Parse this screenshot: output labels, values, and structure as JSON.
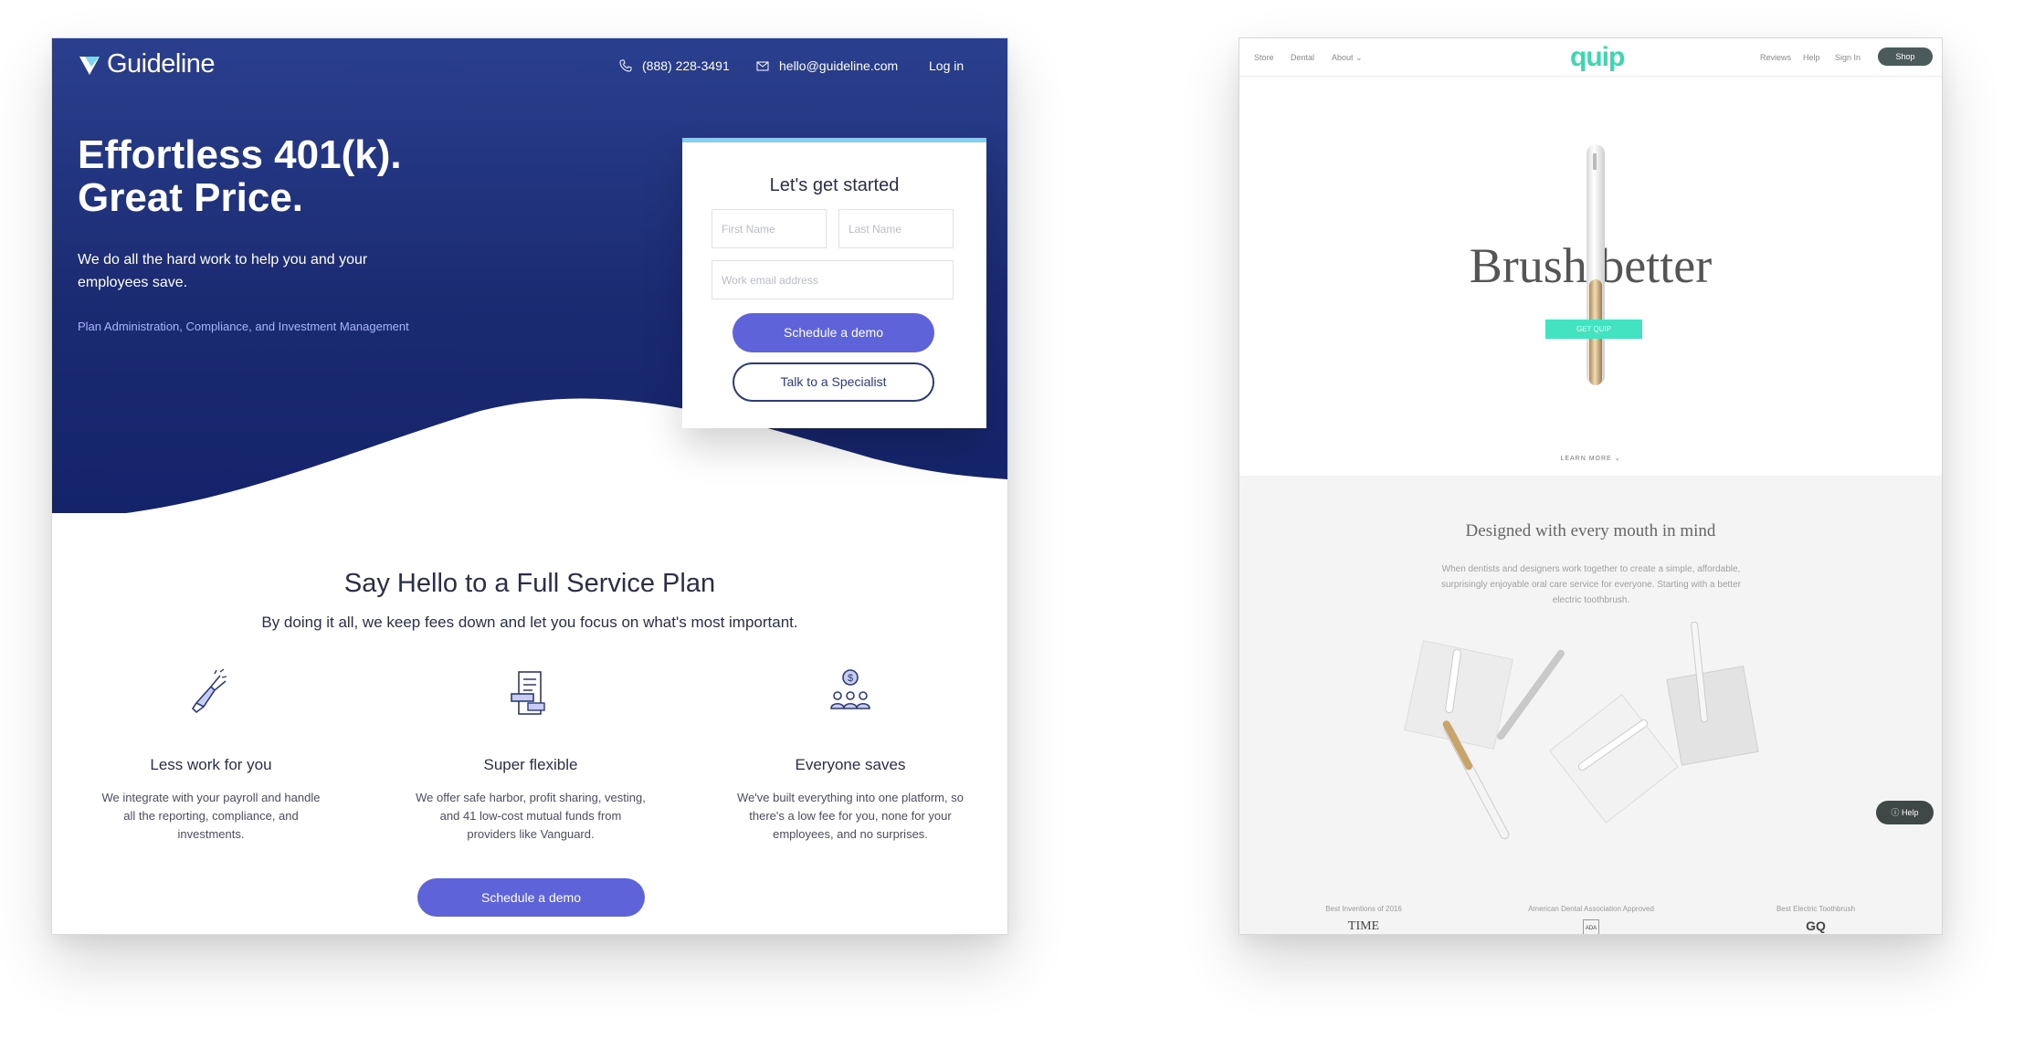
{
  "guideline": {
    "brand": "Guideline",
    "phone": "(888) 228-3491",
    "email": "hello@guideline.com",
    "login": "Log in",
    "hero_title_line1": "Effortless 401(k).",
    "hero_title_line2": "Great Price.",
    "hero_sub": "We do all the hard work to help you and your employees save.",
    "hero_tags": "Plan Administration, Compliance, and Investment Management",
    "form": {
      "title": "Let's get started",
      "first_name_placeholder": "First Name",
      "last_name_placeholder": "Last Name",
      "email_placeholder": "Work email address",
      "primary_button": "Schedule a demo",
      "secondary_button": "Talk to a Specialist"
    },
    "section_title": "Say Hello to a Full Service Plan",
    "section_sub": "By doing it all, we keep fees down and let you focus on what's most important.",
    "features": [
      {
        "title": "Less work for you",
        "desc": "We integrate with your payroll and handle all the reporting, compliance, and investments.",
        "icon": "pointing-hand-icon"
      },
      {
        "title": "Super flexible",
        "desc": "We offer safe harbor, profit sharing, vesting, and 41 low-cost mutual funds from providers like Vanguard.",
        "icon": "document-hand-icon"
      },
      {
        "title": "Everyone saves",
        "desc": "We've built everything into one platform, so there's a low fee for you, none for your employees, and no surprises.",
        "icon": "people-dollar-icon"
      }
    ],
    "bottom_button": "Schedule a demo",
    "colors": {
      "hero": "#1b2b72",
      "accent": "#5e63d9",
      "form_top": "#7fd3ee"
    }
  },
  "quip": {
    "nav_left": [
      "Store",
      "Dental",
      "About"
    ],
    "logo": "quip",
    "nav_right": [
      "Reviews",
      "Help",
      "Sign In"
    ],
    "shop": "Shop",
    "hero_title": "Brush better",
    "cta": "GET QUIP",
    "learn_more": "LEARN MORE",
    "section_title": "Designed with every mouth in mind",
    "section_desc": "When dentists and designers work together to create a simple, affordable, surprisingly enjoyable oral care service for everyone. Starting with a better electric toothbrush.",
    "help": "Help",
    "press": [
      {
        "caption": "Best Inventions of 2016",
        "logo": "TIME"
      },
      {
        "caption": "American Dental Association Approved",
        "logo": "ADA"
      },
      {
        "caption": "Best Electric Toothbrush",
        "logo": "GQ"
      }
    ],
    "colors": {
      "brand": "#38d9b0",
      "cta": "#43e3c2",
      "dark": "#4b5a5a"
    }
  }
}
